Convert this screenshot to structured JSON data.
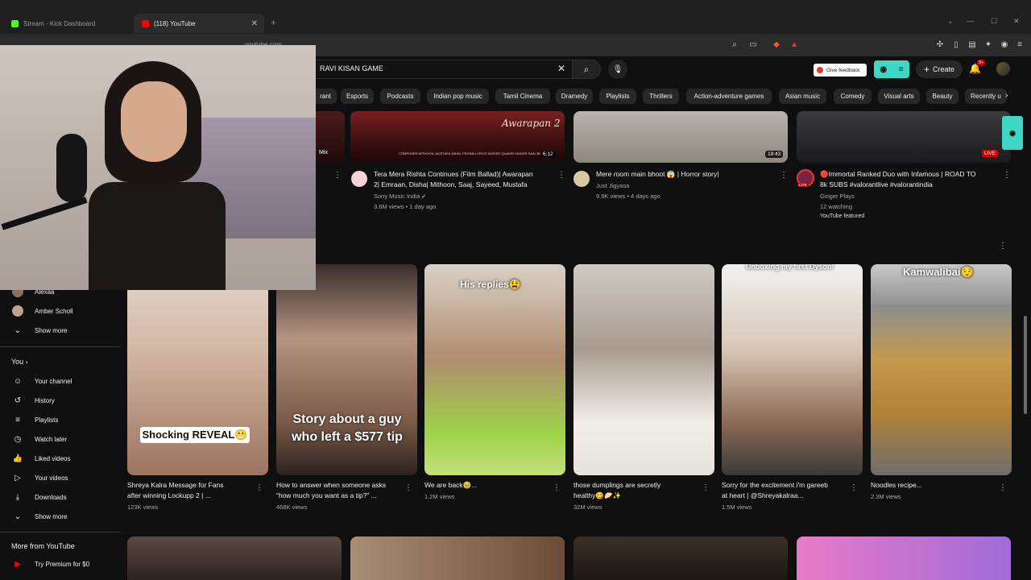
{
  "browser": {
    "tabs": [
      {
        "label": "Stream - Kick Dashboard"
      },
      {
        "label": "(118) YouTube"
      }
    ],
    "url": "youtube.com"
  },
  "youtube": {
    "search_value": "RAVI KISAN GAME",
    "feedback_label": "Give feedback",
    "create_label": "Create",
    "notif_count": "9+",
    "chips": [
      "rant",
      "Esports",
      "Podcasts",
      "Indian pop music",
      "Tamil Cinema",
      "Dramedy",
      "Playlists",
      "Thrillers",
      "Action-adventure games",
      "Asian music",
      "Comedy",
      "Visual arts",
      "Beauty",
      "Recently u"
    ]
  },
  "sidebar": {
    "subs": [
      {
        "label": "Alexaa"
      },
      {
        "label": "Amber Scholl"
      }
    ],
    "show_more_1": "Show more",
    "you_label": "You",
    "you_items": [
      {
        "label": "Your channel",
        "icon": "person-icon"
      },
      {
        "label": "History",
        "icon": "history-icon"
      },
      {
        "label": "Playlists",
        "icon": "playlist-icon"
      },
      {
        "label": "Watch later",
        "icon": "clock-icon"
      },
      {
        "label": "Liked videos",
        "icon": "thumb-up-icon"
      },
      {
        "label": "Your videos",
        "icon": "play-icon"
      },
      {
        "label": "Downloads",
        "icon": "download-icon"
      }
    ],
    "show_more_2": "Show more",
    "more_from": "More from YouTube",
    "premium": "Try Premium for $0"
  },
  "videos_top": [
    {
      "title1": "Tera Mera Rishta Continues (Film Ballad)| Awarapan",
      "title2": "2| Emraan, Disha| Mithoon, Saaj, Sayeed, Mustafa",
      "channel": "Sony Music India",
      "views": "3.6M views • 1 day ago",
      "duration": "6:12",
      "badge": "Mix",
      "thumb_caption": "Awarapan 2",
      "credits": "COMPOSER MITHOON, MUSTAFA ZAHID, PRITAM   LYRICS SAYEED QUADRI   SINGER SAAJ BHATT & SUBODH SHARMA"
    },
    {
      "title1": "Mere room main bhoot 😱 | Horror story|",
      "title2": "",
      "channel": "Just Jigyasa",
      "views": "9.9K views • 4 days ago",
      "duration": "19:43"
    },
    {
      "title1": "🔴Immortal Ranked Duo with Infamous | ROAD TO",
      "title2": "8k SUBS #valorantlive #valorantindia",
      "channel": "Ginger Plays",
      "views": "12 watching",
      "featured": "YouTube featured",
      "live": "LIVE",
      "av_live": "LIVE"
    }
  ],
  "shorts": [
    {
      "title1": "Shreya Kalra Message for Fans",
      "title2": "after winning Lockupp 2 | ...",
      "views": "123K views",
      "overlay": "Shocking REVEAL😬"
    },
    {
      "title1": "How to answer when someone asks",
      "title2": "“how much you want as a tip?” ...",
      "views": "468K views",
      "overlay": "Story about a guy who left a $577 tip"
    },
    {
      "title1": "We are back🥹...",
      "title2": "",
      "views": "1.2M views",
      "overlay": "His replies😫"
    },
    {
      "title1": "those dumplings are secretly",
      "title2": "healthy😋🥟✨",
      "views": "32M views"
    },
    {
      "title1": "Sorry for the excitement i'm gareeb",
      "title2": "at heart | @Shreyakalraa...",
      "views": "1.5M views",
      "overlay": "Unboxing my first Dyson!"
    },
    {
      "title1": "Noodles recipe...",
      "title2": "",
      "views": "2.3M views",
      "overlay": "Kamwalibai😌"
    }
  ],
  "colors": {
    "accent": "#3ed6c5",
    "yt_red": "#ff0000",
    "bg": "#0f0f0f"
  }
}
